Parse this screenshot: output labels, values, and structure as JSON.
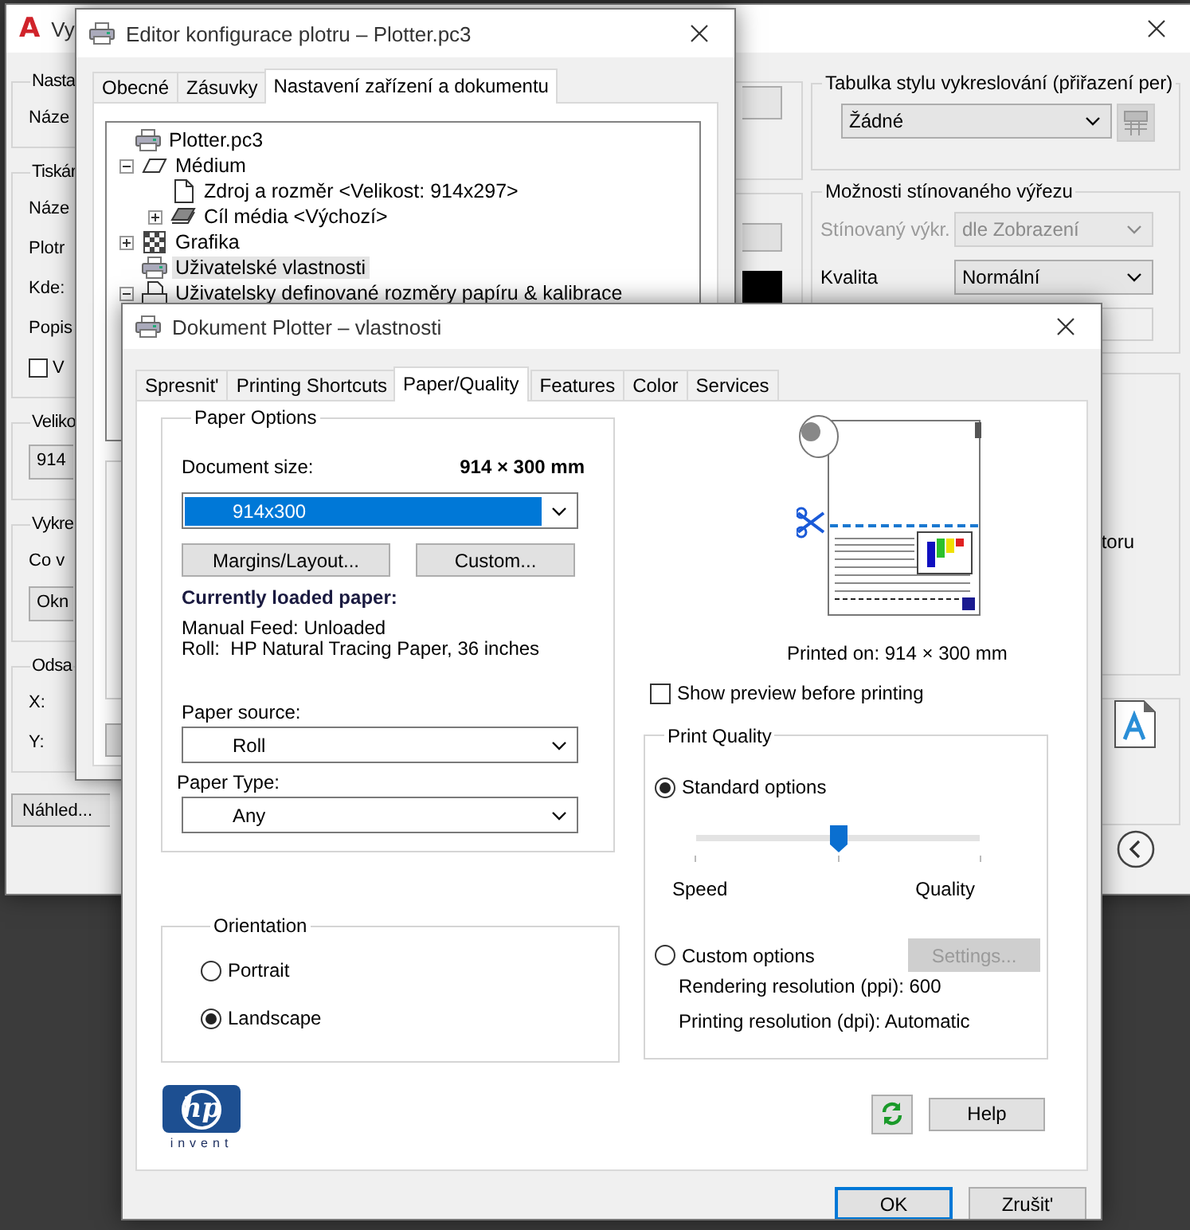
{
  "plot_dialog": {
    "logo": "A",
    "title": "Vy",
    "left_groups": [
      {
        "title": "Nasta",
        "rows": [
          {
            "kind": "label",
            "text": "Náze"
          }
        ]
      },
      {
        "title": "Tiskár",
        "rows": [
          {
            "kind": "label",
            "text": "Náze"
          },
          {
            "kind": "label",
            "text": "Plotr"
          },
          {
            "kind": "label",
            "text": "Kde:"
          },
          {
            "kind": "label",
            "text": "Popis"
          },
          {
            "kind": "checkbox",
            "text": "V",
            "checked": false
          }
        ]
      },
      {
        "title": "Veliko",
        "rows": [
          {
            "kind": "field",
            "text": "914"
          }
        ]
      },
      {
        "title": "Vykre",
        "rows": [
          {
            "kind": "label",
            "text": "Co v"
          },
          {
            "kind": "field",
            "text": "Okn"
          }
        ]
      },
      {
        "title": "Odsa",
        "rows": [
          {
            "kind": "label",
            "text": "X:"
          },
          {
            "kind": "label",
            "text": "Y:"
          }
        ]
      }
    ],
    "preview_button": "Náhled...",
    "plot_style_group": {
      "title": "Tabulka stylu vykreslování (přiřazení per)",
      "dropdown": "Žádné"
    },
    "shaded_group": {
      "title": "Možnosti stínovaného výřezu",
      "rows": [
        {
          "label": "Stínovaný výkr.",
          "value": "dle Zobrazení",
          "disabled": true
        },
        {
          "label": "Kvalita",
          "value": "Normální",
          "disabled": false
        }
      ]
    },
    "side_text": "toru"
  },
  "config_editor": {
    "title": "Editor konfigurace plotru – Plotter.pc3",
    "tabs": [
      {
        "label": "Obecné",
        "selected": false
      },
      {
        "label": "Zásuvky",
        "selected": false
      },
      {
        "label": "Nastavení zařízení a dokumentu",
        "selected": true
      }
    ],
    "tree": [
      {
        "label": "Plotter.pc3",
        "kind": "plotter",
        "selected": false,
        "children": [
          {
            "label": "Médium",
            "kind": "media",
            "expanded": true,
            "selected": false,
            "children": [
              {
                "label": "Zdroj a rozměr <Velikost: 914x297>",
                "kind": "sheet",
                "selected": false
              },
              {
                "label": "Cíl média <Výchozí>",
                "kind": "media-stack",
                "expanded": false,
                "selected": false
              }
            ]
          },
          {
            "label": "Grafika",
            "kind": "graphics",
            "expanded": false,
            "selected": false
          },
          {
            "label": "Uživatelské vlastnosti",
            "kind": "plotter",
            "selected": true
          },
          {
            "label": "Uživatelsky definované rozměry papíru & kalibrace",
            "kind": "sheet-printer",
            "expanded": true,
            "selected": false
          }
        ]
      }
    ]
  },
  "properties_dialog": {
    "title": "Dokument Plotter – vlastnosti",
    "tabs": [
      {
        "label": "Spresnit'",
        "selected": false
      },
      {
        "label": "Printing Shortcuts",
        "selected": false
      },
      {
        "label": "Paper/Quality",
        "selected": true
      },
      {
        "label": "Features",
        "selected": false
      },
      {
        "label": "Color",
        "selected": false
      },
      {
        "label": "Services",
        "selected": false
      }
    ],
    "paper_options": {
      "title": "Paper Options",
      "document_size_label": "Document size:",
      "document_size_value": "914 × 300 mm",
      "size_dropdown": "914x300",
      "buttons": [
        "Margins/Layout...",
        "Custom..."
      ],
      "loaded_heading": "Currently loaded paper:",
      "loaded_lines": [
        "Manual Feed: Unloaded",
        "Roll:  HP Natural Tracing Paper, 36 inches"
      ],
      "source_label": "Paper source:",
      "source_dropdown": "Roll",
      "type_label": "Paper Type:",
      "type_dropdown": "Any"
    },
    "orientation": {
      "title": "Orientation",
      "options": [
        {
          "label": "Portrait",
          "selected": false
        },
        {
          "label": "Landscape",
          "selected": true
        }
      ]
    },
    "logo": {
      "mark": "hp",
      "tagline": "invent"
    },
    "printed_on": "Printed on: 914 × 300 mm",
    "show_preview": {
      "label": "Show preview before printing",
      "checked": false
    },
    "print_quality": {
      "title": "Print Quality",
      "options": [
        {
          "label": "Standard options",
          "selected": true
        },
        {
          "label": "Custom options",
          "selected": false
        }
      ],
      "slider": {
        "level": 0.5
      },
      "slider_labels": [
        "Speed",
        "Quality"
      ],
      "settings_button": {
        "label": "Settings...",
        "disabled": true
      },
      "details": [
        "Rendering resolution (ppi): 600",
        "Printing resolution (dpi): Automatic"
      ]
    },
    "help_button": "Help",
    "ok_button": "OK",
    "cancel_button": "Zrušit'"
  }
}
